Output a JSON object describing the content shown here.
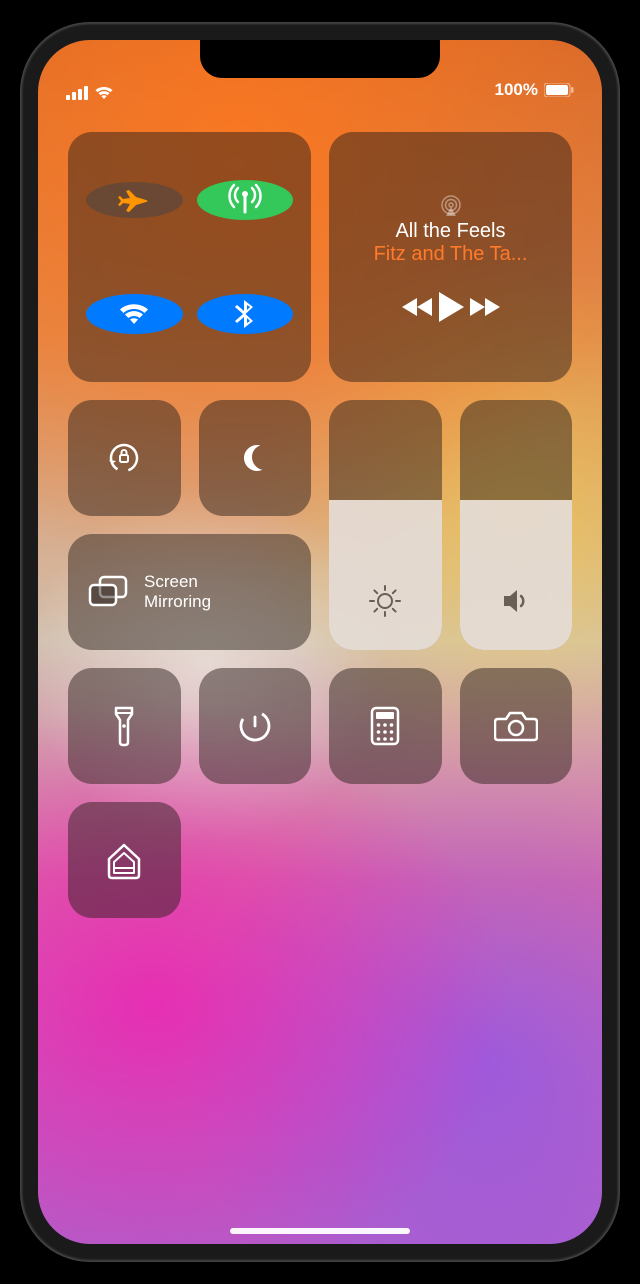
{
  "status": {
    "battery_percent": "100%"
  },
  "connectivity": {
    "airplane_mode": false,
    "cellular": true,
    "wifi": true,
    "bluetooth": true
  },
  "music": {
    "song_title": "All the Feels",
    "artist": "Fitz and The Ta..."
  },
  "screen_mirroring": {
    "label_line1": "Screen",
    "label_line2": "Mirroring"
  },
  "sliders": {
    "brightness": 60,
    "volume": 60
  },
  "colors": {
    "green": "#34c759",
    "blue": "#007aff",
    "artist": "#ff7a2a"
  }
}
